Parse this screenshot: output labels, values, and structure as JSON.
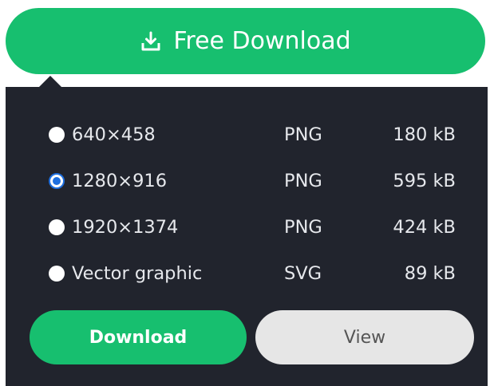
{
  "header_button": {
    "label": "Free Download",
    "icon": "download-tray-icon"
  },
  "options": [
    {
      "resolution": "640×458",
      "format": "PNG",
      "size": "180 kB",
      "selected": false
    },
    {
      "resolution": "1280×916",
      "format": "PNG",
      "size": "595 kB",
      "selected": true
    },
    {
      "resolution": "1920×1374",
      "format": "PNG",
      "size": "424 kB",
      "selected": false
    },
    {
      "resolution": "Vector graphic",
      "format": "SVG",
      "size": "89 kB",
      "selected": false
    }
  ],
  "actions": {
    "download_label": "Download",
    "view_label": "View"
  },
  "colors": {
    "accent_green": "#17bf6f",
    "panel_dark": "#21242d",
    "radio_selected": "#1e6fe0",
    "view_button_bg": "#e6e6e6"
  }
}
